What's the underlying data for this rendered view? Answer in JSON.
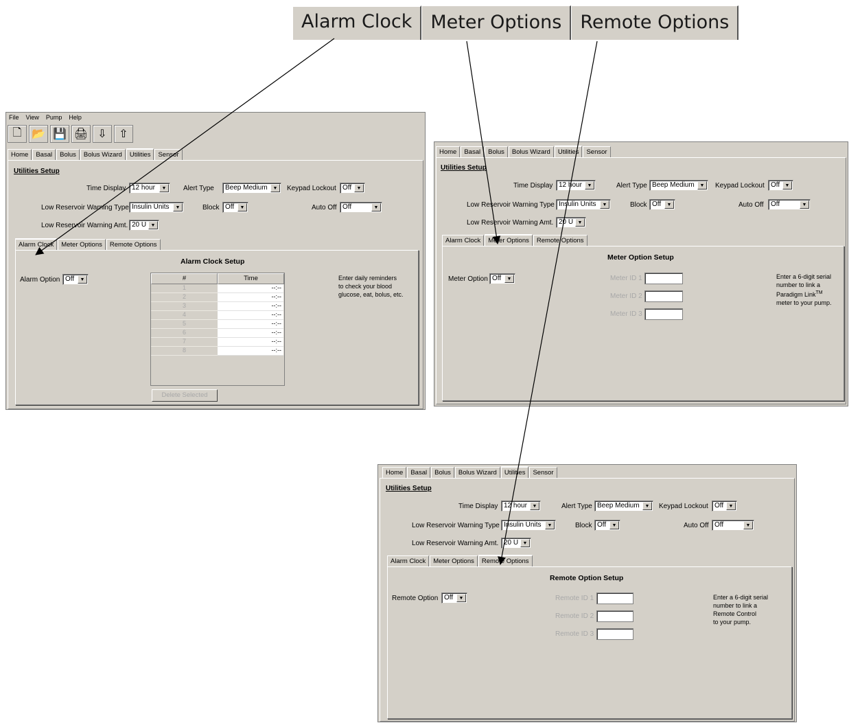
{
  "big_tabs": [
    "Alarm Clock",
    "Meter Options",
    "Remote Options"
  ],
  "menu": [
    "File",
    "View",
    "Pump",
    "Help"
  ],
  "tabs": [
    "Home",
    "Basal",
    "Bolus",
    "Bolus Wizard",
    "Utilities",
    "Sensor"
  ],
  "setup": {
    "heading": "Utilities Setup",
    "time_display_label": "Time Display",
    "time_display_value": "12 hour",
    "alert_type_label": "Alert Type",
    "alert_type_value": "Beep Medium",
    "keypad_lockout_label": "Keypad Lockout",
    "keypad_lockout_value": "Off",
    "low_res_type_label": "Low Reservoir Warning Type",
    "low_res_type_value": "Insulin Units",
    "block_label": "Block",
    "block_value": "Off",
    "auto_off_label": "Auto Off",
    "auto_off_value": "Off",
    "low_res_amt_label": "Low Reservoir Warning Amt.",
    "low_res_amt_value": "20 U"
  },
  "subtabs": [
    "Alarm Clock",
    "Meter Options",
    "Remote Options"
  ],
  "alarm": {
    "title": "Alarm Clock Setup",
    "option_label": "Alarm Option",
    "option_value": "Off",
    "col_num": "#",
    "col_time": "Time",
    "rows": [
      {
        "n": "1",
        "t": "--:--"
      },
      {
        "n": "2",
        "t": "--:--"
      },
      {
        "n": "3",
        "t": "--:--"
      },
      {
        "n": "4",
        "t": "--:--"
      },
      {
        "n": "5",
        "t": "--:--"
      },
      {
        "n": "6",
        "t": "--:--"
      },
      {
        "n": "7",
        "t": "--:--"
      },
      {
        "n": "8",
        "t": "--:--"
      }
    ],
    "delete_button": "Delete Selected",
    "help": [
      "Enter daily reminders",
      "to check your blood",
      "glucose, eat, bolus, etc."
    ]
  },
  "meter": {
    "title": "Meter Option Setup",
    "option_label": "Meter Option",
    "option_value": "Off",
    "ids": [
      "Meter ID 1",
      "Meter ID 2",
      "Meter ID 3"
    ],
    "help": [
      "Enter a 6-digit serial",
      "number to link a",
      "Paradigm Link",
      "meter to your pump."
    ],
    "tm": "TM"
  },
  "remote": {
    "title": "Remote Option Setup",
    "option_label": "Remote Option",
    "option_value": "Off",
    "ids": [
      "Remote ID 1",
      "Remote ID 2",
      "Remote ID 3"
    ],
    "help": [
      "Enter a 6-digit serial",
      "number to link a",
      "Remote Control",
      "to your pump."
    ]
  }
}
